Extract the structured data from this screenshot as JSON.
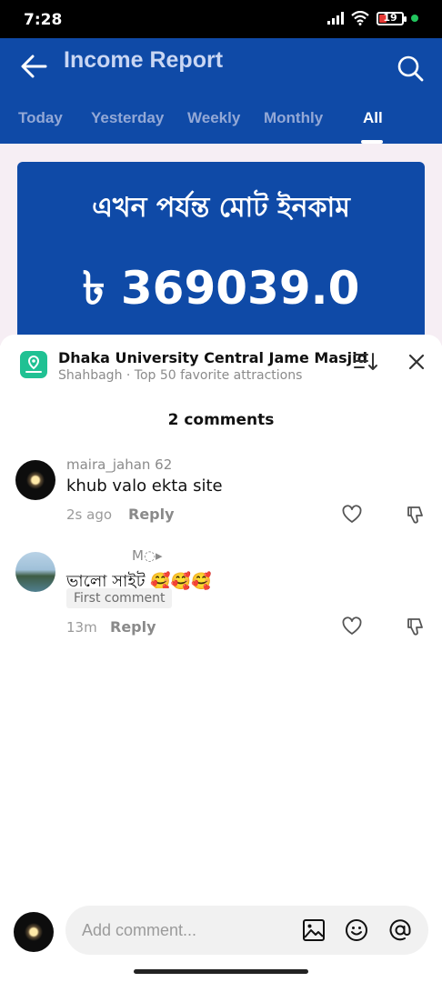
{
  "status_bar": {
    "time": "7:28",
    "battery": "19",
    "battery_level_percent": 19
  },
  "header": {
    "title": "Income Report",
    "tabs": [
      {
        "label": "Today"
      },
      {
        "label": "Yesterday"
      },
      {
        "label": "Weekly"
      },
      {
        "label": "Monthly"
      },
      {
        "label": "All"
      }
    ],
    "active_tab": "All"
  },
  "card": {
    "headline": "এখন পর্যন্ত মোট ইনকাম",
    "amount": "৳ 369039.0"
  },
  "sheet": {
    "place_name": "Dhaka University Central Jame Masjid",
    "place_subtitle": "Shahbagh · Top 50 favorite attractions",
    "comment_count": "2 comments",
    "comments": [
      {
        "username": "maira_jahan 62",
        "text": "khub valo ekta site",
        "time": "2s ago",
        "reply": "Reply"
      },
      {
        "username": "M◌▸",
        "text": "ভালো সাইট 🥰🥰🥰",
        "badge": "First comment",
        "time": "13m",
        "reply": "Reply"
      }
    ],
    "composer_placeholder": "Add comment..."
  },
  "colors": {
    "brand": "#0f4aa7",
    "accent_green": "#20c193"
  },
  "icons": [
    "back-arrow-icon",
    "search-icon",
    "location-pin-icon",
    "sort-icon",
    "close-icon",
    "heart-icon",
    "dislike-icon",
    "image-icon",
    "emoji-icon",
    "mention-icon"
  ]
}
